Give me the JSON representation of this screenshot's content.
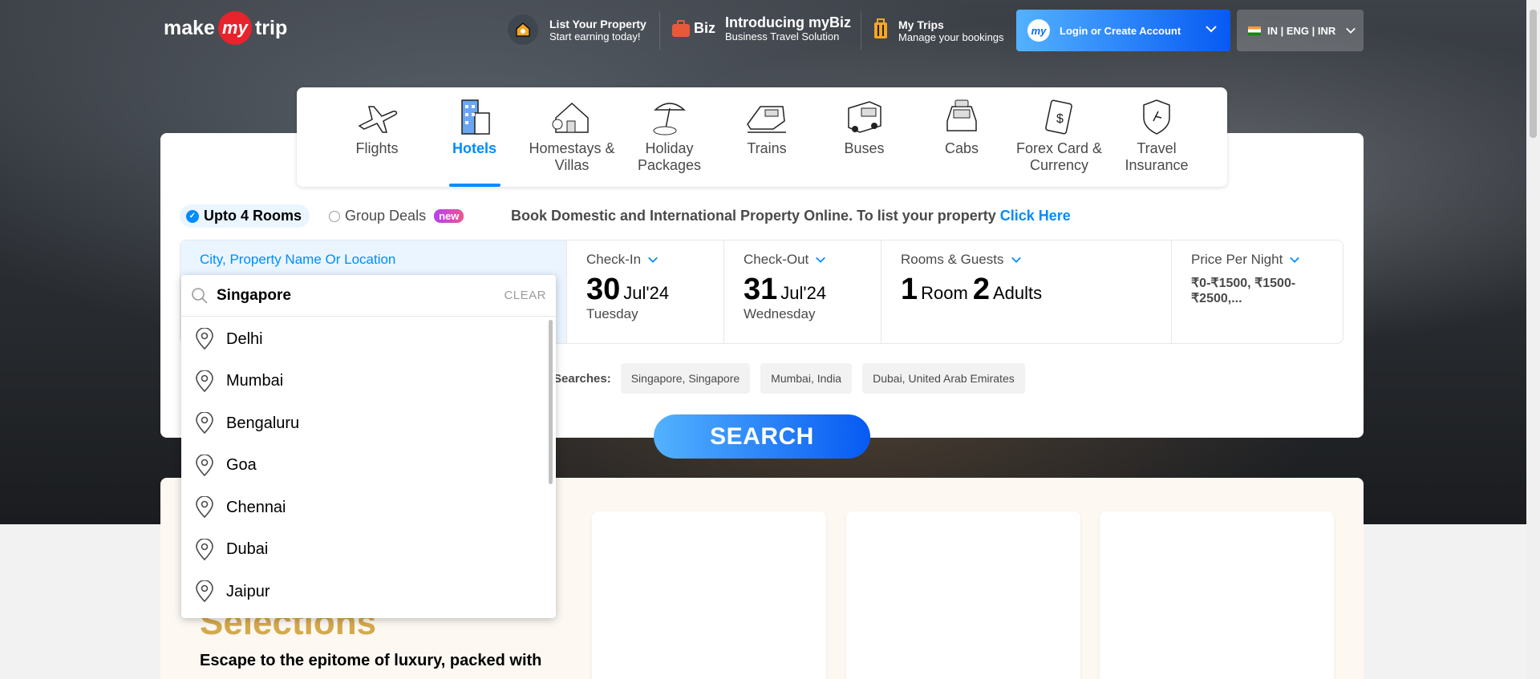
{
  "header": {
    "logo": {
      "make": "make",
      "my": "my",
      "trip": "trip"
    },
    "list_property": {
      "title": "List Your Property",
      "subtitle": "Start earning today!"
    },
    "mybiz": {
      "badge": "Biz",
      "title": "Introducing myBiz",
      "subtitle": "Business Travel Solution"
    },
    "my_trips": {
      "title": "My Trips",
      "subtitle": "Manage your bookings"
    },
    "login_label": "Login or Create Account",
    "avatar_label": "my",
    "lang_label": "IN | ENG | INR"
  },
  "tabs": [
    {
      "label": "Flights",
      "icon": "flight-icon"
    },
    {
      "label": "Hotels",
      "icon": "hotel-icon",
      "active": true
    },
    {
      "label": "Homestays & Villas",
      "icon": "homestay-icon"
    },
    {
      "label": "Holiday Packages",
      "icon": "holiday-icon"
    },
    {
      "label": "Trains",
      "icon": "train-icon"
    },
    {
      "label": "Buses",
      "icon": "bus-icon"
    },
    {
      "label": "Cabs",
      "icon": "cab-icon"
    },
    {
      "label": "Forex Card & Currency",
      "icon": "forex-icon"
    },
    {
      "label": "Travel Insurance",
      "icon": "insurance-icon"
    }
  ],
  "options": {
    "rooms_label": "Upto 4 Rooms",
    "group_label": "Group Deals",
    "new_badge": "new"
  },
  "promo": {
    "text": "Book Domestic and International Property Online. To list your property ",
    "link": "Click Here"
  },
  "fields": {
    "city_label": "City, Property Name Or Location",
    "checkin": {
      "label": "Check-In",
      "day": "30",
      "month": "Jul'24",
      "weekday": "Tuesday"
    },
    "checkout": {
      "label": "Check-Out",
      "day": "31",
      "month": "Jul'24",
      "weekday": "Wednesday"
    },
    "guests": {
      "label": "Rooms & Guests",
      "rooms": "1",
      "rooms_unit": "Room",
      "adults": "2",
      "adults_unit": "Adults"
    },
    "price": {
      "label": "Price Per Night",
      "value": "₹0-₹1500, ₹1500-₹2500,..."
    }
  },
  "recent": {
    "label": "Searches:",
    "chips": [
      "Singapore, Singapore",
      "Mumbai, India",
      "Dubai, United Arab Emirates"
    ]
  },
  "search_button": "SEARCH",
  "dropdown": {
    "query": "Singapore",
    "clear_label": "CLEAR",
    "items": [
      "Delhi",
      "Mumbai",
      "Bengaluru",
      "Goa",
      "Chennai",
      "Dubai",
      "Jaipur"
    ]
  },
  "selections": {
    "title": "Selections",
    "desc": "Escape to the epitome of luxury, packed with"
  },
  "colors": {
    "accent": "#008cff",
    "brand_red": "#e8232b",
    "gold": "#d4a94a"
  }
}
